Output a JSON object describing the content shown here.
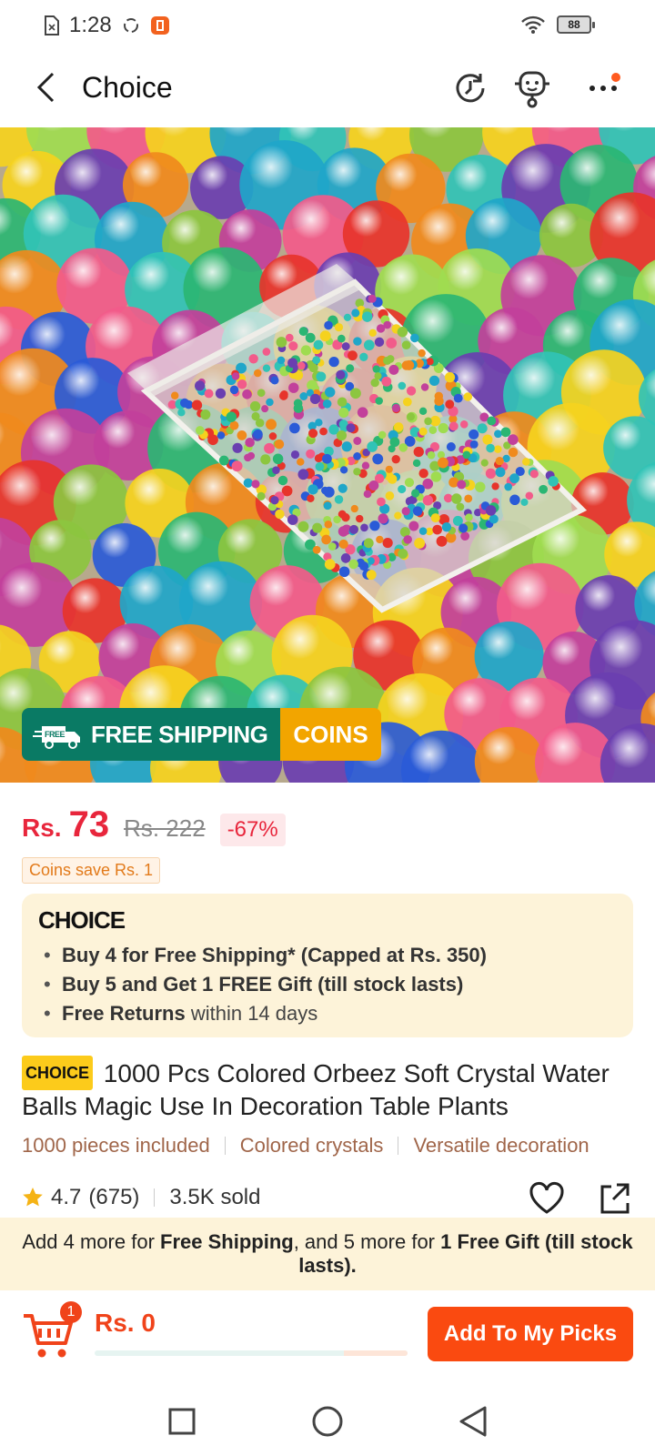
{
  "status_bar": {
    "time": "1:28",
    "battery": "88",
    "icons": [
      "sim-card-icon",
      "sync-icon",
      "app-notification-icon",
      "wifi-icon",
      "battery-icon"
    ]
  },
  "header": {
    "title": "Choice",
    "icons": [
      "back-arrow-icon",
      "history-icon",
      "support-bot-icon",
      "more-icon"
    ]
  },
  "hero": {
    "badge_free_small": "FREE",
    "badge_free_label": "FREE SHIPPING",
    "badge_coins_label": "COINS",
    "colors": {
      "shipping": "#0a7a64",
      "coins": "#f2a500"
    }
  },
  "price": {
    "currency": "Rs.",
    "value": "73",
    "original": "Rs. 222",
    "discount": "-67%",
    "coins_save": "Coins save Rs. 1"
  },
  "choice": {
    "logo": "CHOICE",
    "items": [
      {
        "bold": "Buy 4 for  Free Shipping* (Capped at Rs. 350)",
        "rest": ""
      },
      {
        "bold": "Buy 5 and Get 1 FREE Gift (till stock lasts)",
        "rest": ""
      },
      {
        "bold": "Free Returns",
        "rest": " within 14 days"
      }
    ]
  },
  "product": {
    "chip": "CHOICE",
    "title": "1000 Pcs Colored Orbeez Soft Crystal Water Balls Magic Use In Decoration Table Plants",
    "tags": [
      "1000 pieces included",
      "Colored crystals",
      "Versatile decoration"
    ]
  },
  "rating": {
    "score": "4.7",
    "count": "(675)",
    "sold": "3.5K sold"
  },
  "promo": {
    "t1": "Add 4 more for ",
    "b1": "Free Shipping",
    "t2": ", and 5 more for ",
    "b2": "1 Free Gift (till stock lasts)."
  },
  "cart": {
    "count": "1",
    "total": "Rs. 0",
    "button": "Add To My Picks",
    "accent": "#fa4a10"
  },
  "nav": {
    "icons": [
      "recents-square-icon",
      "home-circle-icon",
      "back-triangle-icon"
    ]
  }
}
